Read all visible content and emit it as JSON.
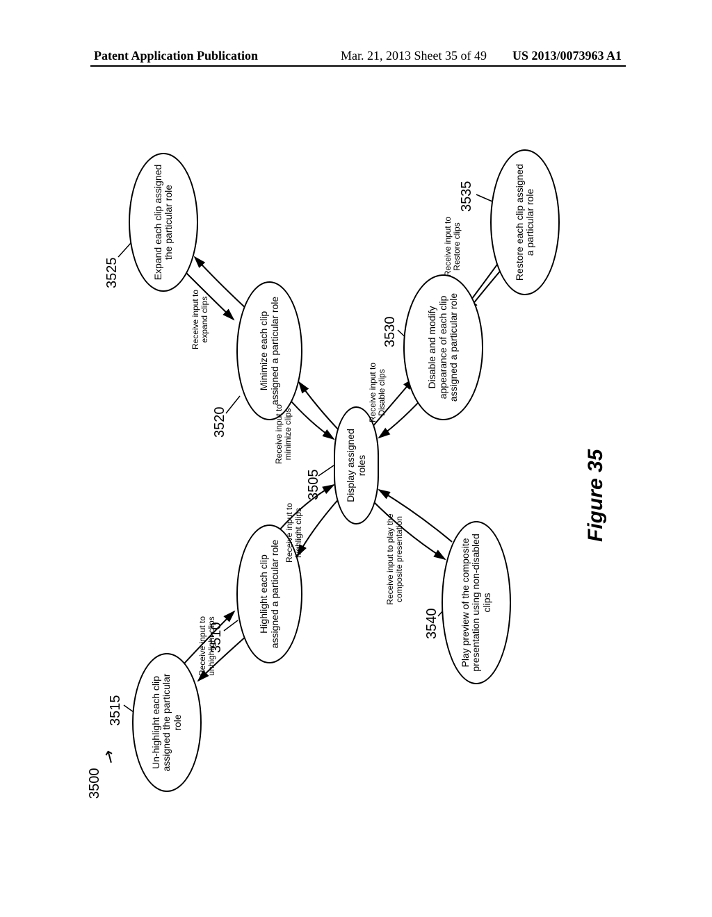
{
  "header": {
    "left": "Patent Application Publication",
    "center": "Mar. 21, 2013  Sheet 35 of 49",
    "right": "US 2013/0073963 A1"
  },
  "figure": {
    "id_label": "3500",
    "caption": "Figure 35"
  },
  "nodes": {
    "center": {
      "ref": "3505",
      "text": "Display assigned roles"
    },
    "highlight": {
      "ref": "3510",
      "text": "Highlight each clip assigned a particular role"
    },
    "unhighlight": {
      "ref": "3515",
      "text": "Un-highlight each clip assigned the particular role"
    },
    "minimize": {
      "ref": "3520",
      "text": "Minimize each clip assigned a particular role"
    },
    "expand": {
      "ref": "3525",
      "text": "Expand each clip assigned the particular role"
    },
    "disable": {
      "ref": "3530",
      "text": "Disable and modify appearance of each clip assigned a particular role"
    },
    "restore": {
      "ref": "3535",
      "text": "Restore each clip assigned a particular role"
    },
    "play": {
      "ref": "3540",
      "text": "Play preview of the composite presentation using non-disabled clips"
    }
  },
  "edges": {
    "highlight": "Receive input to highlight clips",
    "unhighlight": "Receive input to unhighlight clips",
    "minimize": "Receive input to minimize clips",
    "expand": "Receive input to expand clips",
    "disable": "Receive input to Disable clips",
    "restore": "Receive input to Restore clips",
    "play": "Receive input to play the composite presentation"
  }
}
